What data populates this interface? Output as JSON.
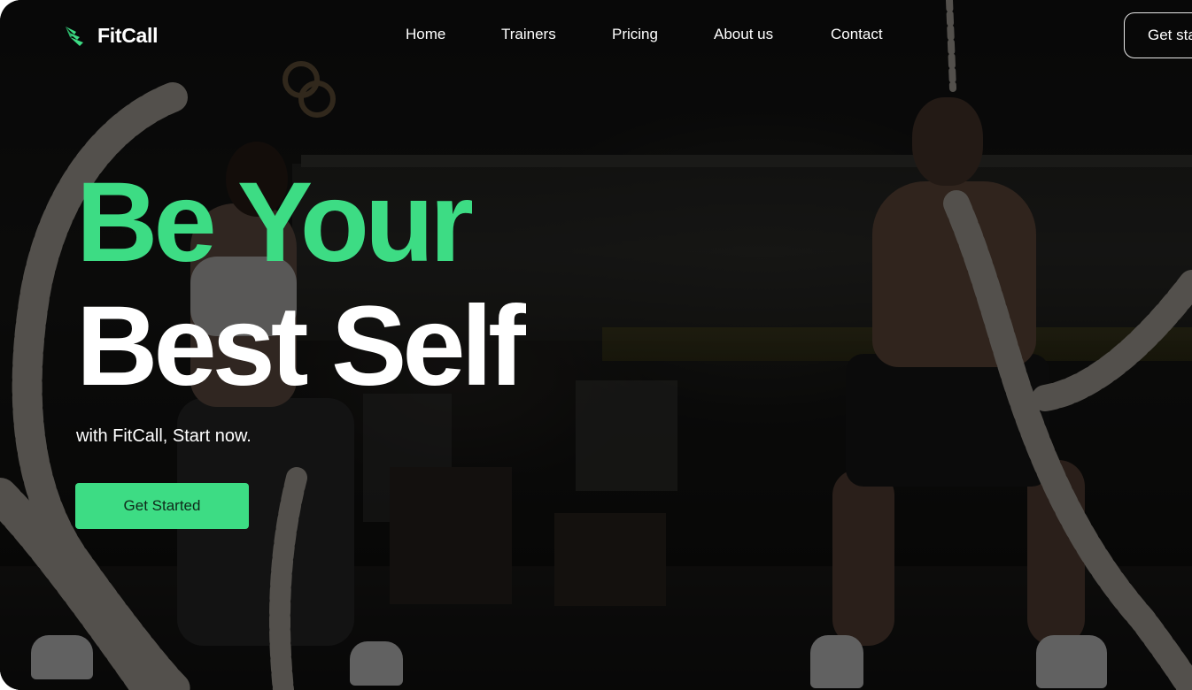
{
  "brand": {
    "name": "FitCall",
    "logo_icon": "wing-icon",
    "accent_color": "#3ddc84"
  },
  "nav": {
    "items": [
      {
        "label": "Home"
      },
      {
        "label": "Trainers"
      },
      {
        "label": "Pricing"
      },
      {
        "label": "About us"
      },
      {
        "label": "Contact"
      }
    ]
  },
  "header_button": {
    "label": "Get started"
  },
  "hero": {
    "headline_line1": "Be Your",
    "headline_line2": "Best Self",
    "subtitle": "with FitCall, Start now.",
    "cta_label": "Get Started"
  },
  "background": {
    "image": "gym-battle-ropes-photo"
  }
}
